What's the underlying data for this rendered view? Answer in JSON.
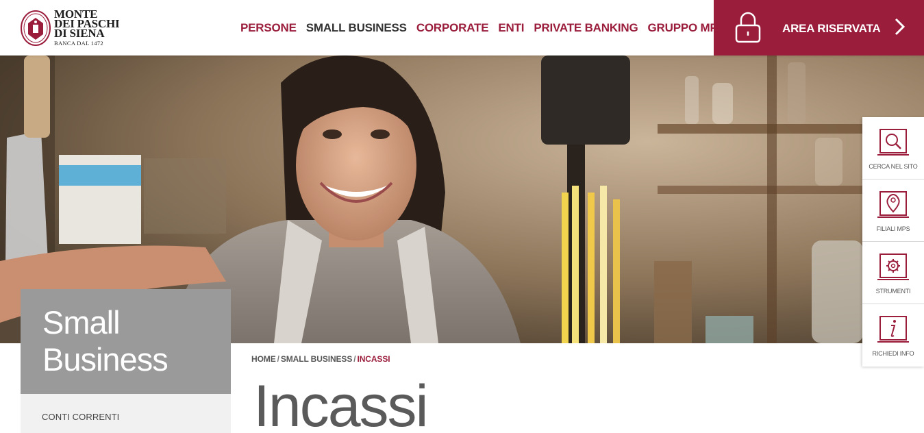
{
  "brand": {
    "logo_lines": [
      "MONTE",
      "DEI PASCHI",
      "DI SIENA"
    ],
    "logo_sub": "BANCA DAL 1472"
  },
  "nav": {
    "items": [
      {
        "label": "PERSONE"
      },
      {
        "label": "SMALL BUSINESS"
      },
      {
        "label": "CORPORATE"
      },
      {
        "label": "ENTI"
      },
      {
        "label": "PRIVATE BANKING"
      },
      {
        "label": "GRUPPO MPS"
      }
    ],
    "active_label": "SMALL BUSINESS"
  },
  "area_riservata": {
    "label": "AREA RISERVATA",
    "icon": "lock-icon"
  },
  "tools": [
    {
      "label": "CERCA NEL SITO",
      "icon": "search-icon"
    },
    {
      "label": "FILIALI MPS",
      "icon": "map-pin-icon"
    },
    {
      "label": "STRUMENTI",
      "icon": "gear-icon"
    },
    {
      "label": "RICHIEDI INFO",
      "icon": "info-icon"
    }
  ],
  "section": {
    "title_line1": "Small",
    "title_line2": "Business",
    "menu_items": [
      "CONTI CORRENTI"
    ]
  },
  "breadcrumb": {
    "home": "HOME",
    "separator": "/",
    "parent": "SMALL BUSINESS",
    "current": "INCASSI"
  },
  "page": {
    "title": "Incassi"
  },
  "colors": {
    "brand": "#9b1d3c",
    "section_box": "#9a9a9a",
    "text_dark": "#333333"
  }
}
